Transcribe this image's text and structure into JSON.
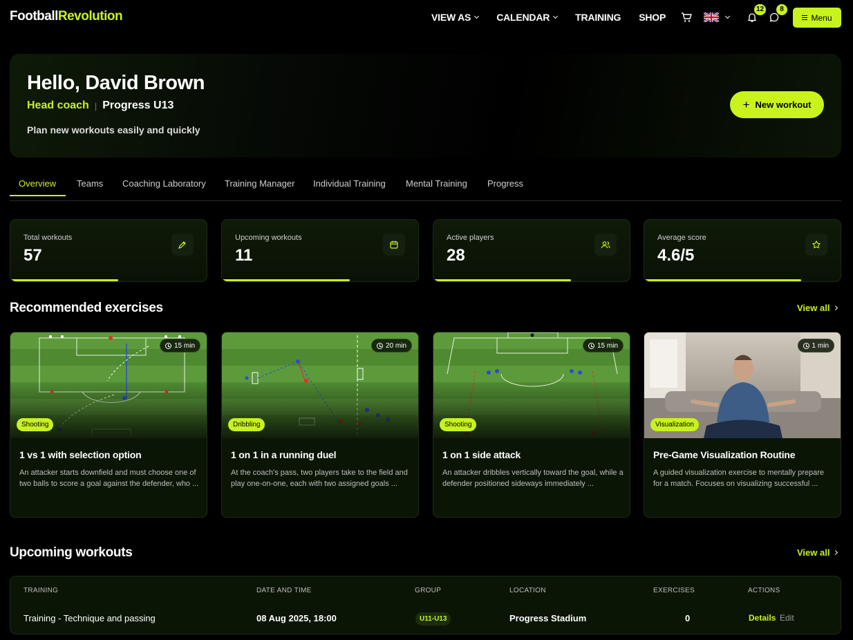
{
  "brand": {
    "part1": "Football",
    "part2": "Revolution"
  },
  "nav": {
    "links": [
      {
        "label": "VIEW AS",
        "dropdown": true
      },
      {
        "label": "CALENDAR",
        "dropdown": true
      },
      {
        "label": "TRAINING",
        "dropdown": false
      },
      {
        "label": "SHOP",
        "dropdown": false
      }
    ],
    "notifications_count": "12",
    "messages_count": "8",
    "menu_label": "Menu"
  },
  "hero": {
    "greeting": "Hello, David Brown",
    "role": "Head coach",
    "team": "Progress U13",
    "subtitle": "Plan new workouts easily and quickly",
    "new_workout_label": "New workout"
  },
  "tabs": [
    "Overview",
    "Teams",
    "Coaching Laboratory",
    "Training Manager",
    "Individual Training",
    "Mental Training",
    "Progress"
  ],
  "stats": [
    {
      "label": "Total workouts",
      "value": "57",
      "icon": "exchange-icon",
      "progress": 0.55
    },
    {
      "label": "Upcoming workouts",
      "value": "11",
      "icon": "calendar-icon",
      "progress": 0.65
    },
    {
      "label": "Active players",
      "value": "28",
      "icon": "users-icon",
      "progress": 0.7
    },
    {
      "label": "Average score",
      "value": "4.6/5",
      "icon": "star-icon",
      "progress": 0.8
    }
  ],
  "exercises_section": {
    "title": "Recommended exercises",
    "view_all": "View all"
  },
  "exercises": [
    {
      "title": "1 vs 1 with selection option",
      "duration": "15 min",
      "tag": "Shooting",
      "description": "An attacker starts downfield and must choose one of two balls to score a goal against the defender, who ..."
    },
    {
      "title": "1 on 1 in a running duel",
      "duration": "20 min",
      "tag": "Dribbling",
      "description": "At the coach's pass, two players take to the field and play one-on-one, each with two assigned goals ..."
    },
    {
      "title": "1 on 1 side attack",
      "duration": "15 min",
      "tag": "Shooting",
      "description": "An attacker dribbles vertically toward the goal, while a defender positioned sideways immediately ..."
    },
    {
      "title": "Pre-Game Visualization Routine",
      "duration": "1 min",
      "tag": "Visualization",
      "description": "A guided visualization exercise to mentally prepare for a match. Focuses on visualizing successful ..."
    }
  ],
  "workouts_section": {
    "title": "Upcoming workouts",
    "view_all": "View all"
  },
  "table": {
    "headers": [
      "TRAINING",
      "DATE AND TIME",
      "GROUP",
      "LOCATION",
      "EXERCISES",
      "ACTIONS"
    ],
    "rows": [
      {
        "training": "Training - Technique and passing",
        "datetime": "08 Aug 2025, 18:00",
        "group": "U11-U13",
        "location": "Progress Stadium",
        "exercises": "0",
        "details": "Details",
        "edit": "Edit"
      }
    ]
  },
  "colors": {
    "accent": "#c8f31d",
    "background": "#000000",
    "card": "#0b1506"
  }
}
